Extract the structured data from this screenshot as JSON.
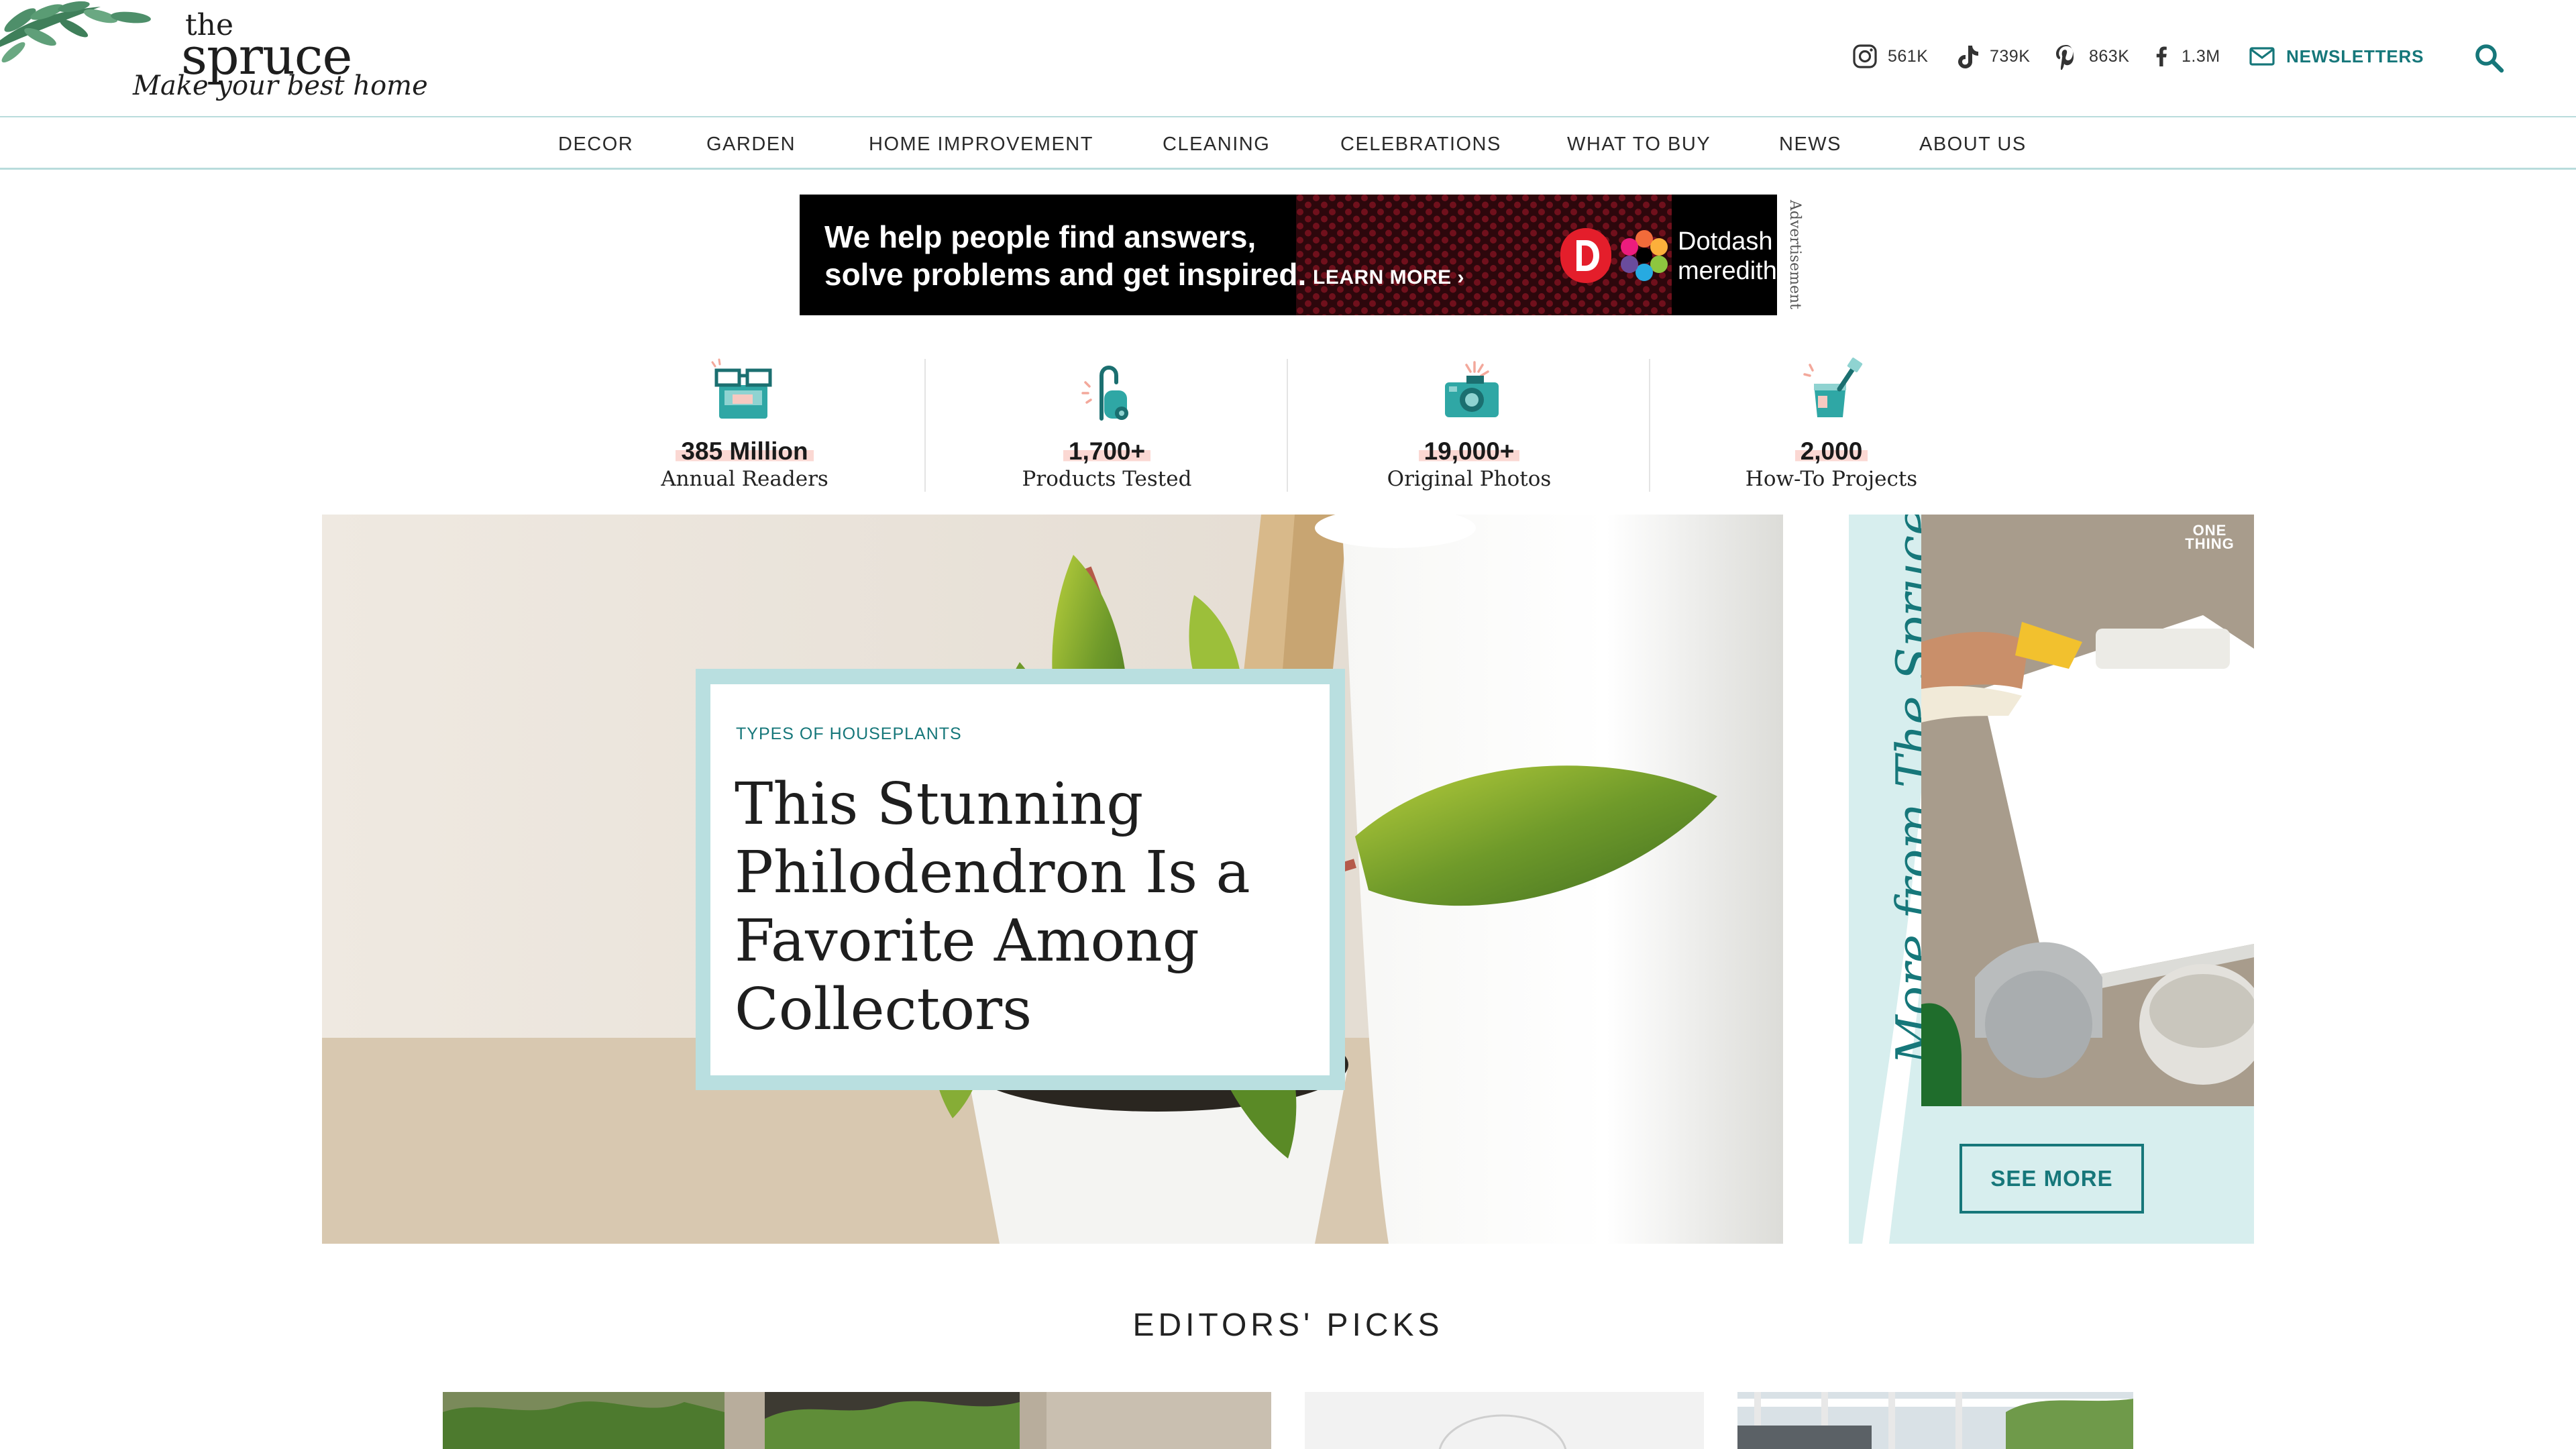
{
  "brand": {
    "name_top": "the",
    "name_main": "spruce",
    "tagline": "Make your best home"
  },
  "social": [
    {
      "icon": "instagram-icon",
      "count": "561K"
    },
    {
      "icon": "tiktok-icon",
      "count": "739K"
    },
    {
      "icon": "pinterest-icon",
      "count": "863K"
    },
    {
      "icon": "facebook-icon",
      "count": "1.3M"
    }
  ],
  "newsletter": {
    "icon": "mail-icon",
    "label": "NEWSLETTERS"
  },
  "search": {
    "icon": "search-icon"
  },
  "nav": [
    "DECOR",
    "GARDEN",
    "HOME IMPROVEMENT",
    "CLEANING",
    "CELEBRATIONS",
    "WHAT TO BUY",
    "NEWS",
    "ABOUT US"
  ],
  "ad": {
    "line1": "We help people find answers,",
    "line2": "solve problems and get inspired.",
    "cta": "LEARN MORE ›",
    "brand_line1": "Dotdash",
    "brand_line2": "meredith",
    "label": "Advertisement"
  },
  "stats": [
    {
      "icon": "glasses-icon",
      "number": "385 Million",
      "label": "Annual Readers"
    },
    {
      "icon": "vacuum-icon",
      "number": "1,700+",
      "label": "Products Tested"
    },
    {
      "icon": "camera-icon",
      "number": "19,000+",
      "label": "Original Photos"
    },
    {
      "icon": "paint-bucket-icon",
      "number": "2,000",
      "label": "How-To Projects"
    }
  ],
  "hero": {
    "category": "TYPES OF HOUSEPLANTS",
    "title": "This Stunning Philodendron Is a Favorite Among Collectors"
  },
  "more": {
    "heading": "More from The Spruce",
    "badge_line1": "ONE",
    "badge_line2": "THING",
    "button": "SEE MORE"
  },
  "editors_picks": {
    "title": "EDITORS' PICKS"
  },
  "colors": {
    "accent": "#16777a",
    "accent_light": "#d7eeee",
    "divider": "#b9dcdc",
    "stat_highlight": "#fbd8d3"
  }
}
